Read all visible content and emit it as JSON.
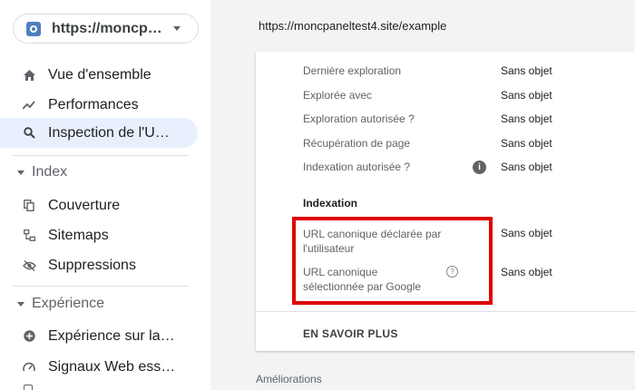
{
  "property": {
    "url": "https://moncp…"
  },
  "nav": {
    "items": [
      {
        "label": "Vue d'ensemble",
        "icon": "home-icon"
      },
      {
        "label": "Performances",
        "icon": "trending-up-icon"
      },
      {
        "label": "Inspection de l'U…",
        "icon": "search-icon",
        "active": true
      }
    ],
    "index": {
      "title": "Index",
      "items": [
        {
          "label": "Couverture",
          "icon": "copy-icon"
        },
        {
          "label": "Sitemaps",
          "icon": "sitemap-icon"
        },
        {
          "label": "Suppressions",
          "icon": "eye-off-icon"
        }
      ]
    },
    "experience": {
      "title": "Expérience",
      "items": [
        {
          "label": "Expérience sur la…",
          "icon": "plus-circle-icon"
        },
        {
          "label": "Signaux Web ess…",
          "icon": "gauge-icon"
        }
      ]
    }
  },
  "page_url": "https://moncpaneltest4.site/example",
  "crawl": {
    "rows": [
      {
        "label": "Dernière exploration",
        "value": "Sans objet"
      },
      {
        "label": "Explorée avec",
        "value": "Sans objet"
      },
      {
        "label": "Exploration autorisée ?",
        "value": "Sans objet"
      },
      {
        "label": "Récupération de page",
        "value": "Sans objet"
      },
      {
        "label": "Indexation autorisée ?",
        "value": "Sans objet"
      }
    ]
  },
  "indexing": {
    "title": "Indexation",
    "rows": [
      {
        "label_line1": "URL canonique déclarée par",
        "label_line2": "l'utilisateur",
        "value": "Sans objet"
      },
      {
        "label_line1": "URL canonique",
        "label_line2": "sélectionnée par Google",
        "value": "Sans objet"
      }
    ]
  },
  "learn_more": "EN SAVOIR PLUS",
  "improvements": "Améliorations",
  "colors": {
    "accent_bg": "#e8f0fe",
    "highlight": "#e00000"
  }
}
